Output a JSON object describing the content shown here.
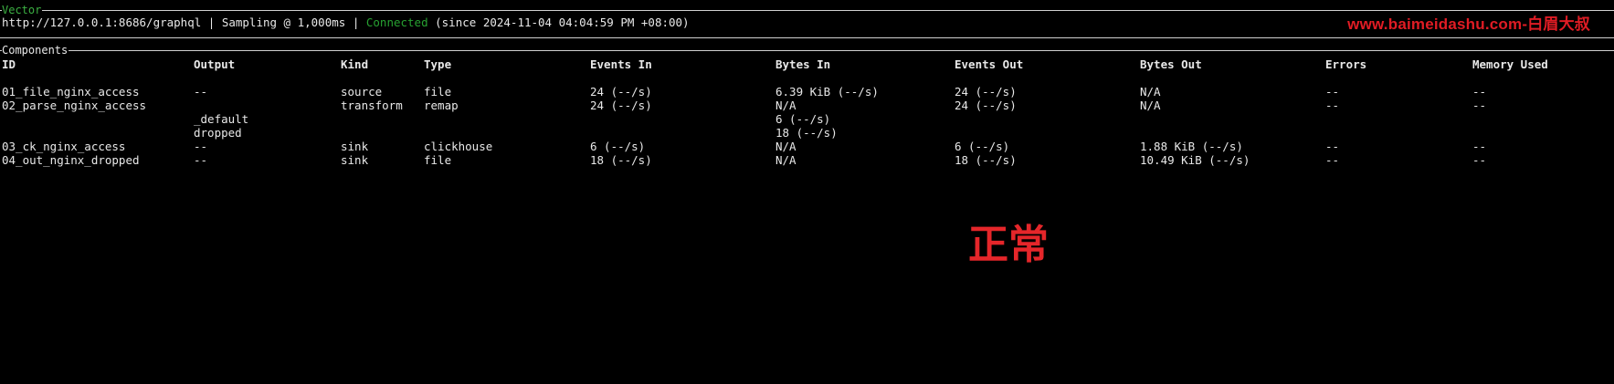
{
  "vector_panel": {
    "title": "Vector",
    "url": "http://127.0.0.1:8686/graphql",
    "sep1": " | ",
    "sampling": "Sampling @ 1,000ms",
    "sep2": " | ",
    "status": "Connected",
    "since": " (since 2024-11-04 04:04:59 PM +08:00)"
  },
  "watermark": "www.baimeidashu.com-白眉大叔",
  "components_panel": {
    "title": "Components",
    "columns": [
      "ID",
      "Output",
      "Kind",
      "Type",
      "Events In",
      "Bytes In",
      "Events Out",
      "Bytes Out",
      "Errors",
      "Memory Used"
    ],
    "rows": [
      {
        "id": "01_file_nginx_access",
        "output": "--",
        "kind": "source",
        "type": "file",
        "events_in": "24 (--/s)",
        "bytes_in": "6.39 KiB (--/s)",
        "events_out": "24 (--/s)",
        "bytes_out": "N/A",
        "errors": "--",
        "memory_used": "--"
      },
      {
        "id": "02_parse_nginx_access",
        "output": "",
        "kind": "transform",
        "type": "remap",
        "events_in": "24 (--/s)",
        "bytes_in": "N/A",
        "events_out": "24 (--/s)",
        "bytes_out": "N/A",
        "errors": "--",
        "memory_used": "--",
        "sub_outputs": [
          {
            "output": "_default",
            "value": "6 (--/s)"
          },
          {
            "output": "dropped",
            "value": "18 (--/s)"
          }
        ]
      },
      {
        "id": "03_ck_nginx_access",
        "output": "--",
        "kind": "sink",
        "type": "clickhouse",
        "events_in": "6 (--/s)",
        "bytes_in": "N/A",
        "events_out": "6 (--/s)",
        "bytes_out": "1.88 KiB (--/s)",
        "errors": "--",
        "memory_used": "--"
      },
      {
        "id": "04_out_nginx_dropped",
        "output": "--",
        "kind": "sink",
        "type": "file",
        "events_in": "18 (--/s)",
        "bytes_in": "N/A",
        "events_out": "18 (--/s)",
        "bytes_out": "10.49 KiB (--/s)",
        "errors": "--",
        "memory_used": "--"
      }
    ]
  },
  "note": "正常",
  "colors": {
    "background": "#000000",
    "text": "#e8e8e8",
    "connected": "#27a131",
    "annotation": "#e5262a"
  }
}
